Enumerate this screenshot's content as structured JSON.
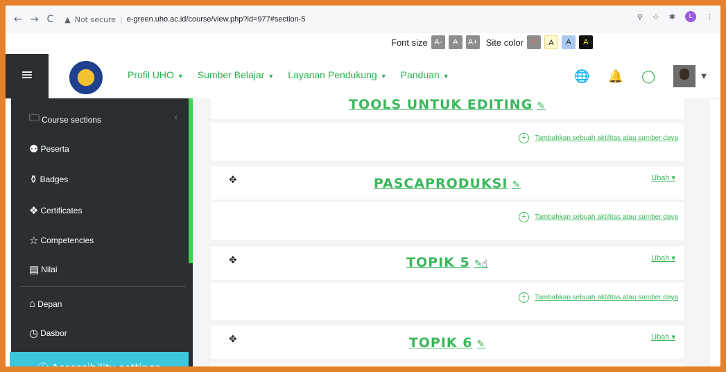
{
  "browser": {
    "back": "←",
    "forward": "→",
    "reload": "C",
    "warning": "▲",
    "not_secure": "Not secure",
    "separator": "|",
    "url": "e-green.uho.ac.id/course/view.php?id=977#section-5",
    "profile_initial": "L"
  },
  "fontbar": {
    "font_size_label": "Font size",
    "decrease": "A-",
    "normal": "A",
    "increase": "A+",
    "site_color_label": "Site color",
    "reset": "R",
    "yellow": "A",
    "blue": "A",
    "black": "A"
  },
  "navbar": {
    "menu": [
      {
        "label": "Profil UHO"
      },
      {
        "label": "Sumber Belajar"
      },
      {
        "label": "Layanan Pendukung"
      },
      {
        "label": "Panduan"
      }
    ]
  },
  "sidebar": {
    "items": [
      {
        "label": "Course sections",
        "icon": "folder-icon"
      },
      {
        "label": "Peserta",
        "icon": "users-icon"
      },
      {
        "label": "Badges",
        "icon": "badges-icon"
      },
      {
        "label": "Certificates",
        "icon": "certificate-icon"
      },
      {
        "label": "Competencies",
        "icon": "star-icon"
      },
      {
        "label": "Nilai",
        "icon": "grades-icon"
      },
      {
        "label": "Depan",
        "icon": "home-icon"
      },
      {
        "label": "Dasbor",
        "icon": "dashboard-icon"
      }
    ],
    "accessibility": "Accessibility settings"
  },
  "main": {
    "sections": [
      {
        "title": "TOOLS UNTUK EDITING"
      },
      {
        "title": "PASCAPRODUKSI",
        "edit": "Ubah"
      },
      {
        "title": "TOPIK 5",
        "edit": "Ubah"
      },
      {
        "title": "TOPIK 6",
        "edit": "Ubah"
      }
    ],
    "add_activity": "Tambahkan sebuah aktifitas atau sumber daya"
  },
  "colors": {
    "accent_green": "#3bb75a",
    "sidebar_bg": "#2b2e33",
    "frame_orange": "#e6812b",
    "access_cyan": "#3cc6dc"
  }
}
